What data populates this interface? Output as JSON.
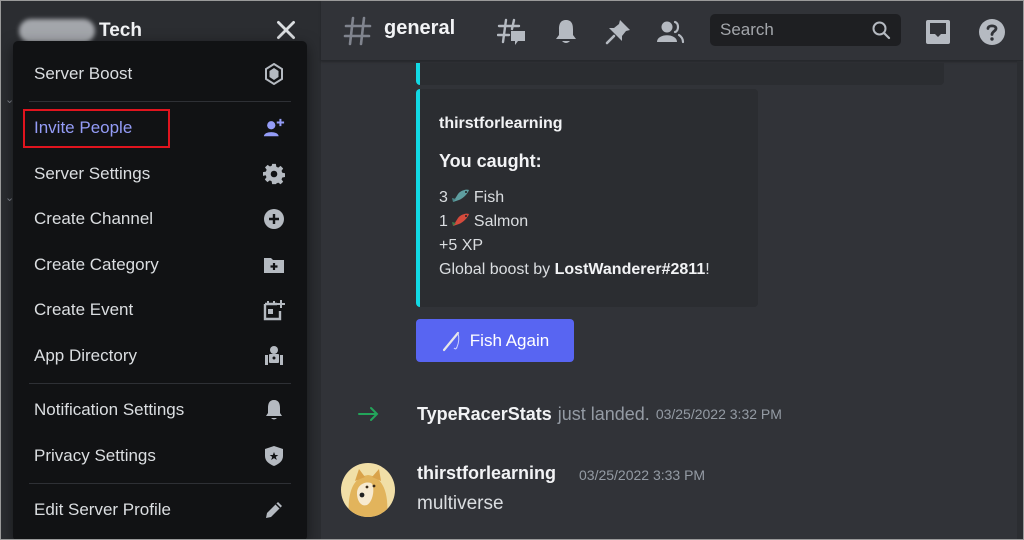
{
  "sidebar": {
    "server_name_visible": "Tech",
    "menu": {
      "items": [
        {
          "label": "Server Boost",
          "icon": "boost-gem-icon"
        },
        {
          "label": "Invite People",
          "icon": "add-user-icon",
          "highlighted": true
        },
        {
          "label": "Server Settings",
          "icon": "gear-icon"
        },
        {
          "label": "Create Channel",
          "icon": "plus-circle-icon"
        },
        {
          "label": "Create Category",
          "icon": "folder-plus-icon"
        },
        {
          "label": "Create Event",
          "icon": "calendar-plus-icon"
        },
        {
          "label": "App Directory",
          "icon": "robot-icon"
        },
        {
          "label": "Notification Settings",
          "icon": "bell-icon"
        },
        {
          "label": "Privacy Settings",
          "icon": "shield-star-icon"
        },
        {
          "label": "Edit Server Profile",
          "icon": "pencil-icon"
        }
      ]
    }
  },
  "header": {
    "channel_name": "general",
    "search_placeholder": "Search"
  },
  "embed": {
    "author": "thirstforlearning",
    "title": "You caught:",
    "lines": {
      "fish_count": "3",
      "fish_label": "Fish",
      "salmon_count": "1",
      "salmon_label": "Salmon",
      "xp": "+5 XP",
      "boost_prefix": "Global boost by ",
      "boost_user": "LostWanderer#2811",
      "boost_suffix": "!"
    },
    "accent_color": "#12d9e4"
  },
  "fish_again_button": {
    "label": "Fish Again",
    "color": "#5865f2"
  },
  "join_message": {
    "username": "TypeRacerStats",
    "text": "just landed.",
    "timestamp": "03/25/2022 3:32 PM"
  },
  "message": {
    "author": "thirstforlearning",
    "timestamp": "03/25/2022 3:33 PM",
    "body": "multiverse"
  },
  "colors": {
    "highlight_box": "#e0141e",
    "invite_accent": "#949cf7"
  }
}
